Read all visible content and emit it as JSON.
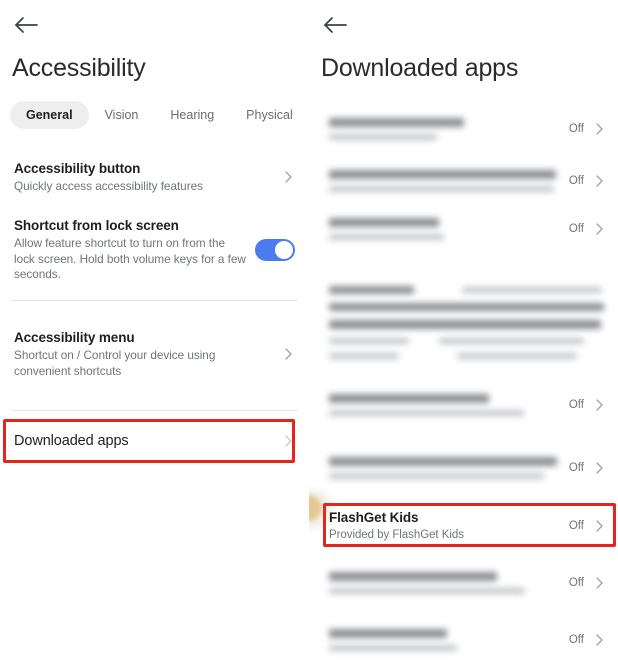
{
  "left_panel": {
    "back_label": "Back",
    "title": "Accessibility",
    "tabs": [
      {
        "label": "General",
        "active": true
      },
      {
        "label": "Vision",
        "active": false
      },
      {
        "label": "Hearing",
        "active": false
      },
      {
        "label": "Physical",
        "active": false
      }
    ],
    "settings": [
      {
        "title": "Accessibility button",
        "subtitle": "Quickly access accessibility features",
        "control": "chevron"
      },
      {
        "title": "Shortcut from lock screen",
        "subtitle": "Allow feature shortcut to turn on from the lock screen. Hold both volume keys for a few seconds.",
        "control": "toggle",
        "toggle_on": true
      },
      {
        "title": "Accessibility menu",
        "subtitle": "Shortcut on / Control your device using convenient shortcuts",
        "control": "chevron"
      },
      {
        "title": "Downloaded apps",
        "subtitle": "",
        "control": "chevron",
        "highlighted": true
      }
    ]
  },
  "right_panel": {
    "back_label": "Back",
    "title": "Downloaded apps",
    "state_off": "Off",
    "apps": [
      {
        "name": "",
        "provider": "",
        "state": "Off",
        "redacted": true
      },
      {
        "name": "",
        "provider": "",
        "state": "Off",
        "redacted": true
      },
      {
        "name": "",
        "provider": "",
        "state": "Off",
        "redacted": true
      },
      {
        "name": "",
        "provider": "",
        "state": "",
        "redacted": true
      },
      {
        "name": "",
        "provider": "",
        "state": "Off",
        "redacted": true
      },
      {
        "name": "",
        "provider": "",
        "state": "Off",
        "redacted": true
      },
      {
        "name": "FlashGet Kids",
        "provider": "Provided by FlashGet Kids",
        "state": "Off",
        "redacted": false,
        "highlighted": true
      },
      {
        "name": "",
        "provider": "",
        "state": "Off",
        "redacted": true
      },
      {
        "name": "",
        "provider": "",
        "state": "Off",
        "redacted": true
      }
    ]
  },
  "colors": {
    "accent_toggle": "#4a7cf0",
    "highlight_box": "#e5241b",
    "text_primary": "#1f1f1f",
    "text_secondary": "#70757a",
    "tab_active_bg": "#eeeeee",
    "divider": "#e6e6e6"
  }
}
